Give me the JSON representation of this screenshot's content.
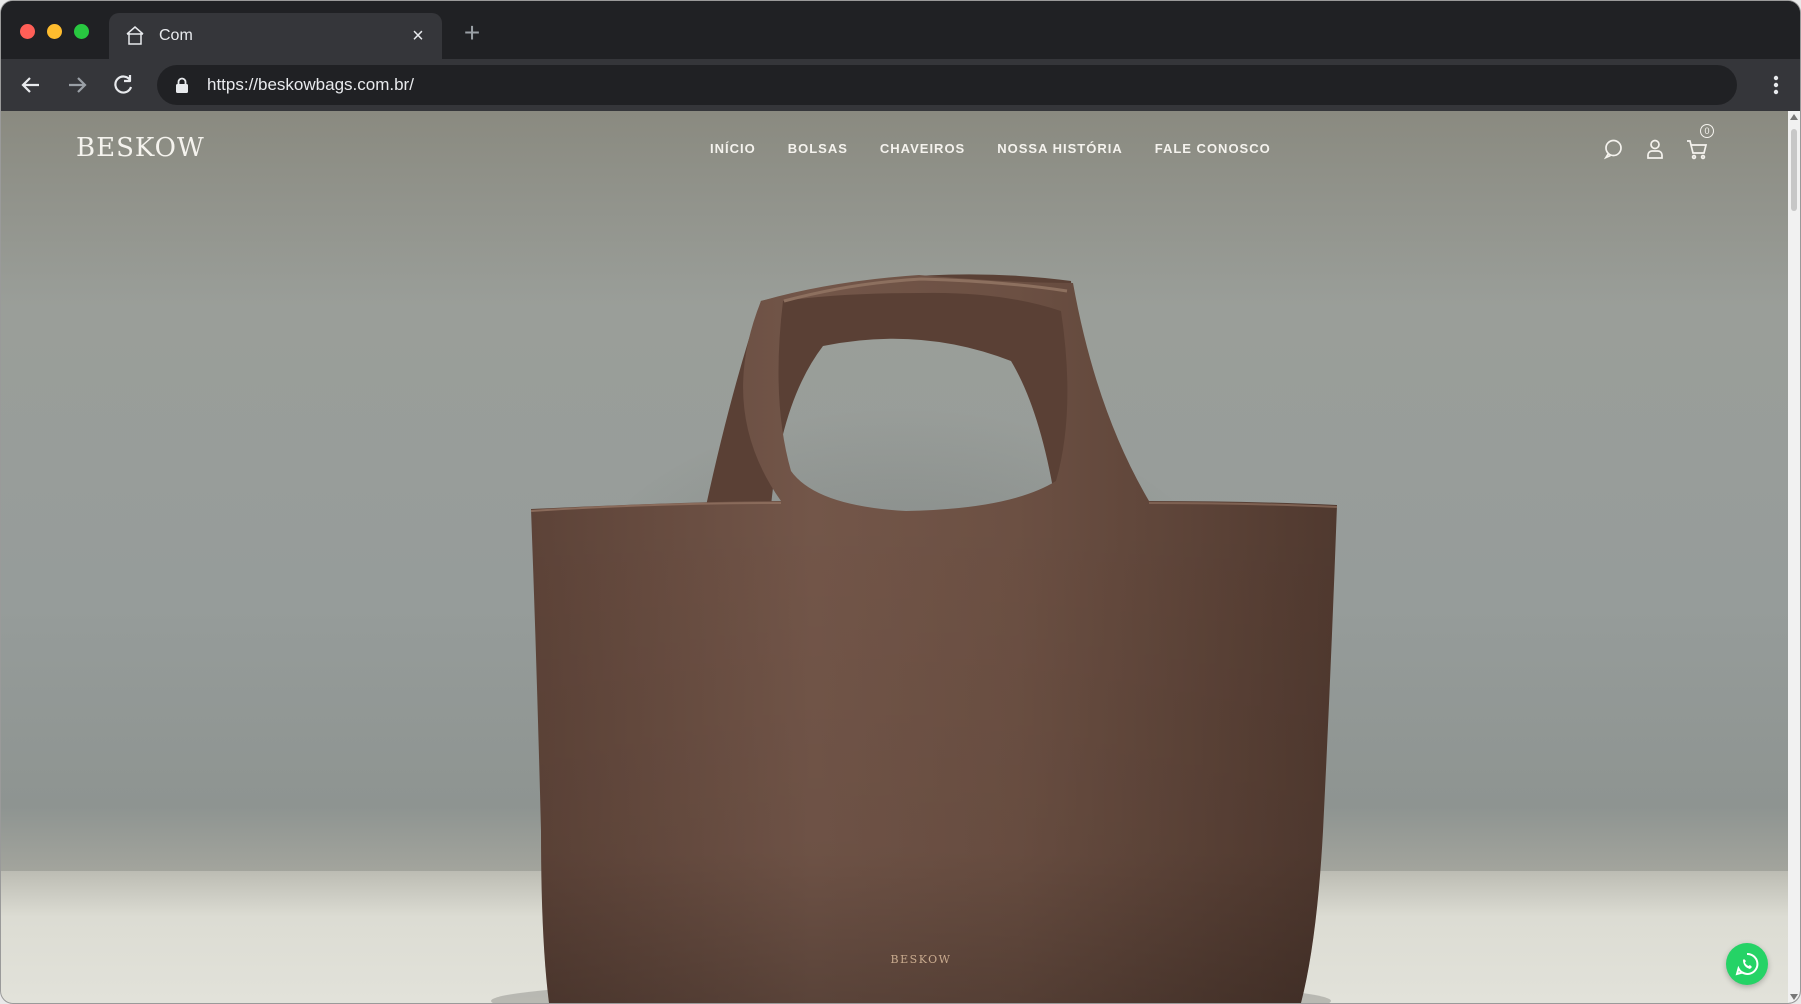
{
  "browser": {
    "tab": {
      "title": "Com",
      "favicon": "store-icon",
      "close": "×"
    },
    "new_tab_label": "+",
    "url": "https://beskowbags.com.br/"
  },
  "site": {
    "logo": "BESKOW",
    "nav": [
      "INÍCIO",
      "BOLSAS",
      "CHAVEIROS",
      "NOSSA HISTÓRIA",
      "FALE CONOSCO"
    ],
    "icons": [
      "chat-icon",
      "user-icon",
      "cart-icon"
    ],
    "cart_count": "0",
    "hero": {
      "bag_brand": "BESKOW",
      "bag_color": "#6b4f42"
    },
    "whatsapp_icon": "whatsapp-icon",
    "colors": {
      "header_text": "#f5f3ee",
      "whatsapp": "#25d366"
    }
  }
}
